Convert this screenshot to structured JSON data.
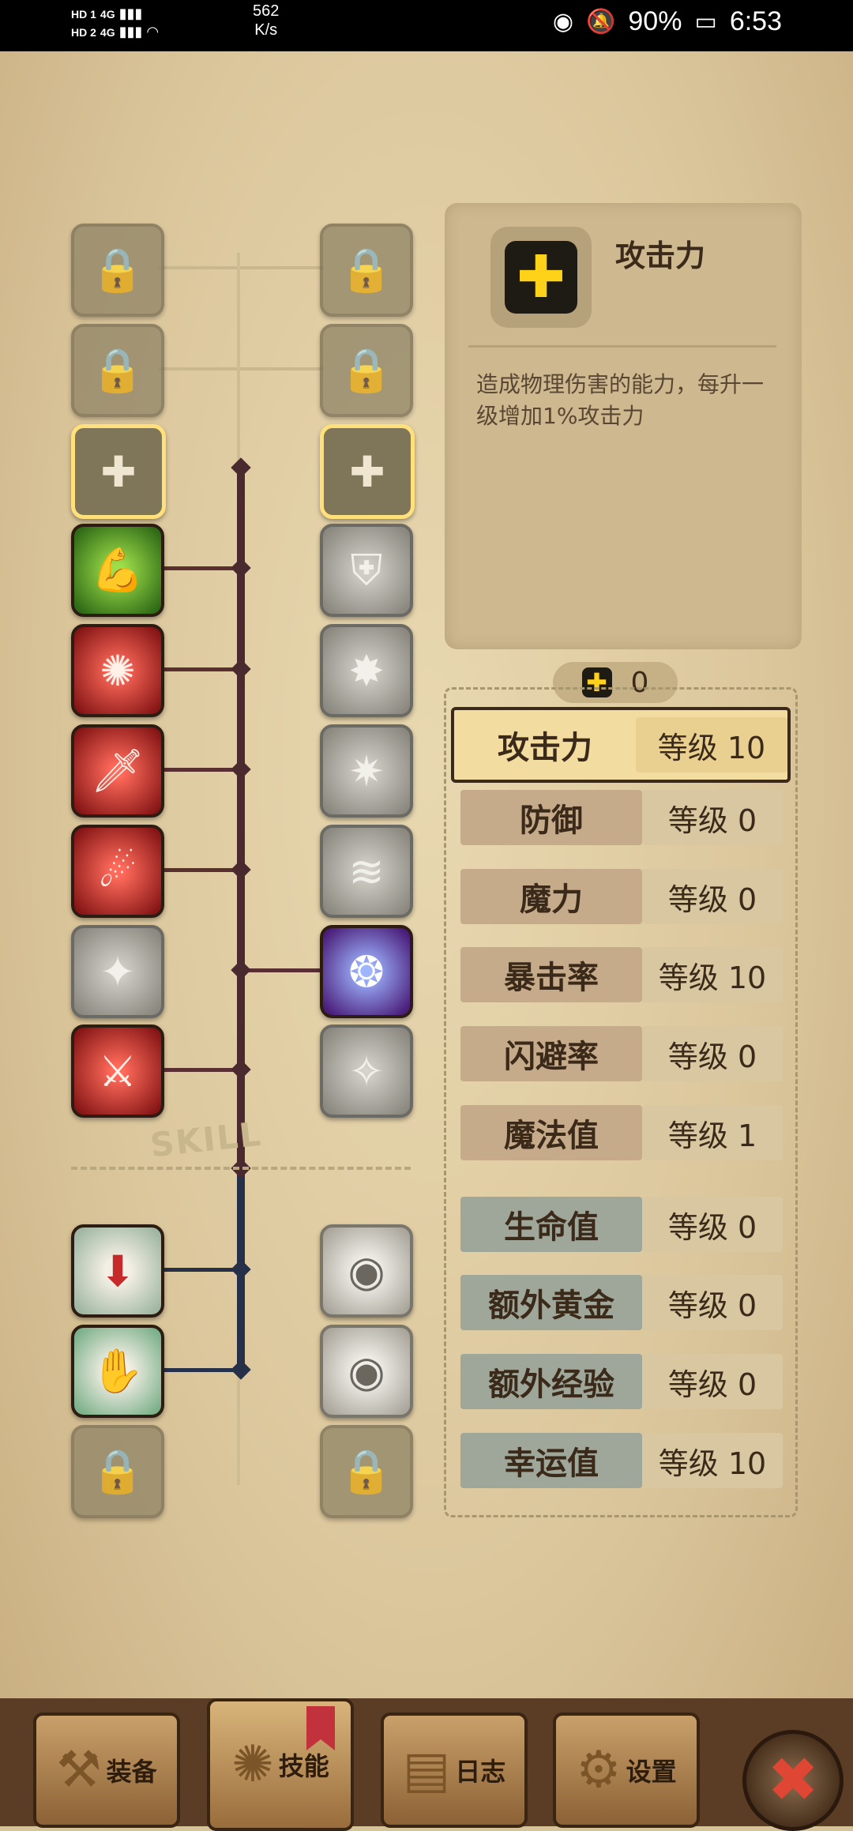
{
  "status_bar": {
    "sim1": "HD 1",
    "sim2": "HD 2",
    "net1": "4G",
    "net2": "4G",
    "speed_value": "562",
    "speed_unit": "K/s",
    "battery": "90%",
    "time": "6:53"
  },
  "skill_tree": {
    "watermark": "SKILL"
  },
  "info_panel": {
    "title": "攻击力",
    "description": "造成物理伤害的能力，每升一级增加1%攻击力",
    "icon": "plus-icon"
  },
  "points": {
    "value": "0",
    "icon": "plus-icon"
  },
  "stats": [
    {
      "label": "攻击力",
      "level": "等级 10"
    },
    {
      "label": "防御",
      "level": "等级 0"
    },
    {
      "label": "魔力",
      "level": "等级 0"
    },
    {
      "label": "暴击率",
      "level": "等级 10"
    },
    {
      "label": "闪避率",
      "level": "等级 0"
    },
    {
      "label": "魔法值",
      "level": "等级 1"
    },
    {
      "label": "生命值",
      "level": "等级 0"
    },
    {
      "label": "额外黄金",
      "level": "等级 0"
    },
    {
      "label": "额外经验",
      "level": "等级 0"
    },
    {
      "label": "幸运值",
      "level": "等级 10"
    }
  ],
  "tabs": [
    {
      "label": "装备",
      "icon": "axe-icon"
    },
    {
      "label": "技能",
      "icon": "skill-icon"
    },
    {
      "label": "日志",
      "icon": "book-icon"
    },
    {
      "label": "设置",
      "icon": "gear-icon"
    }
  ],
  "colors": {
    "paper": "#dcc79d",
    "gold_highlight": "#ffe07a",
    "tree_line": "#4a2a2e",
    "close_red": "#e04634"
  }
}
